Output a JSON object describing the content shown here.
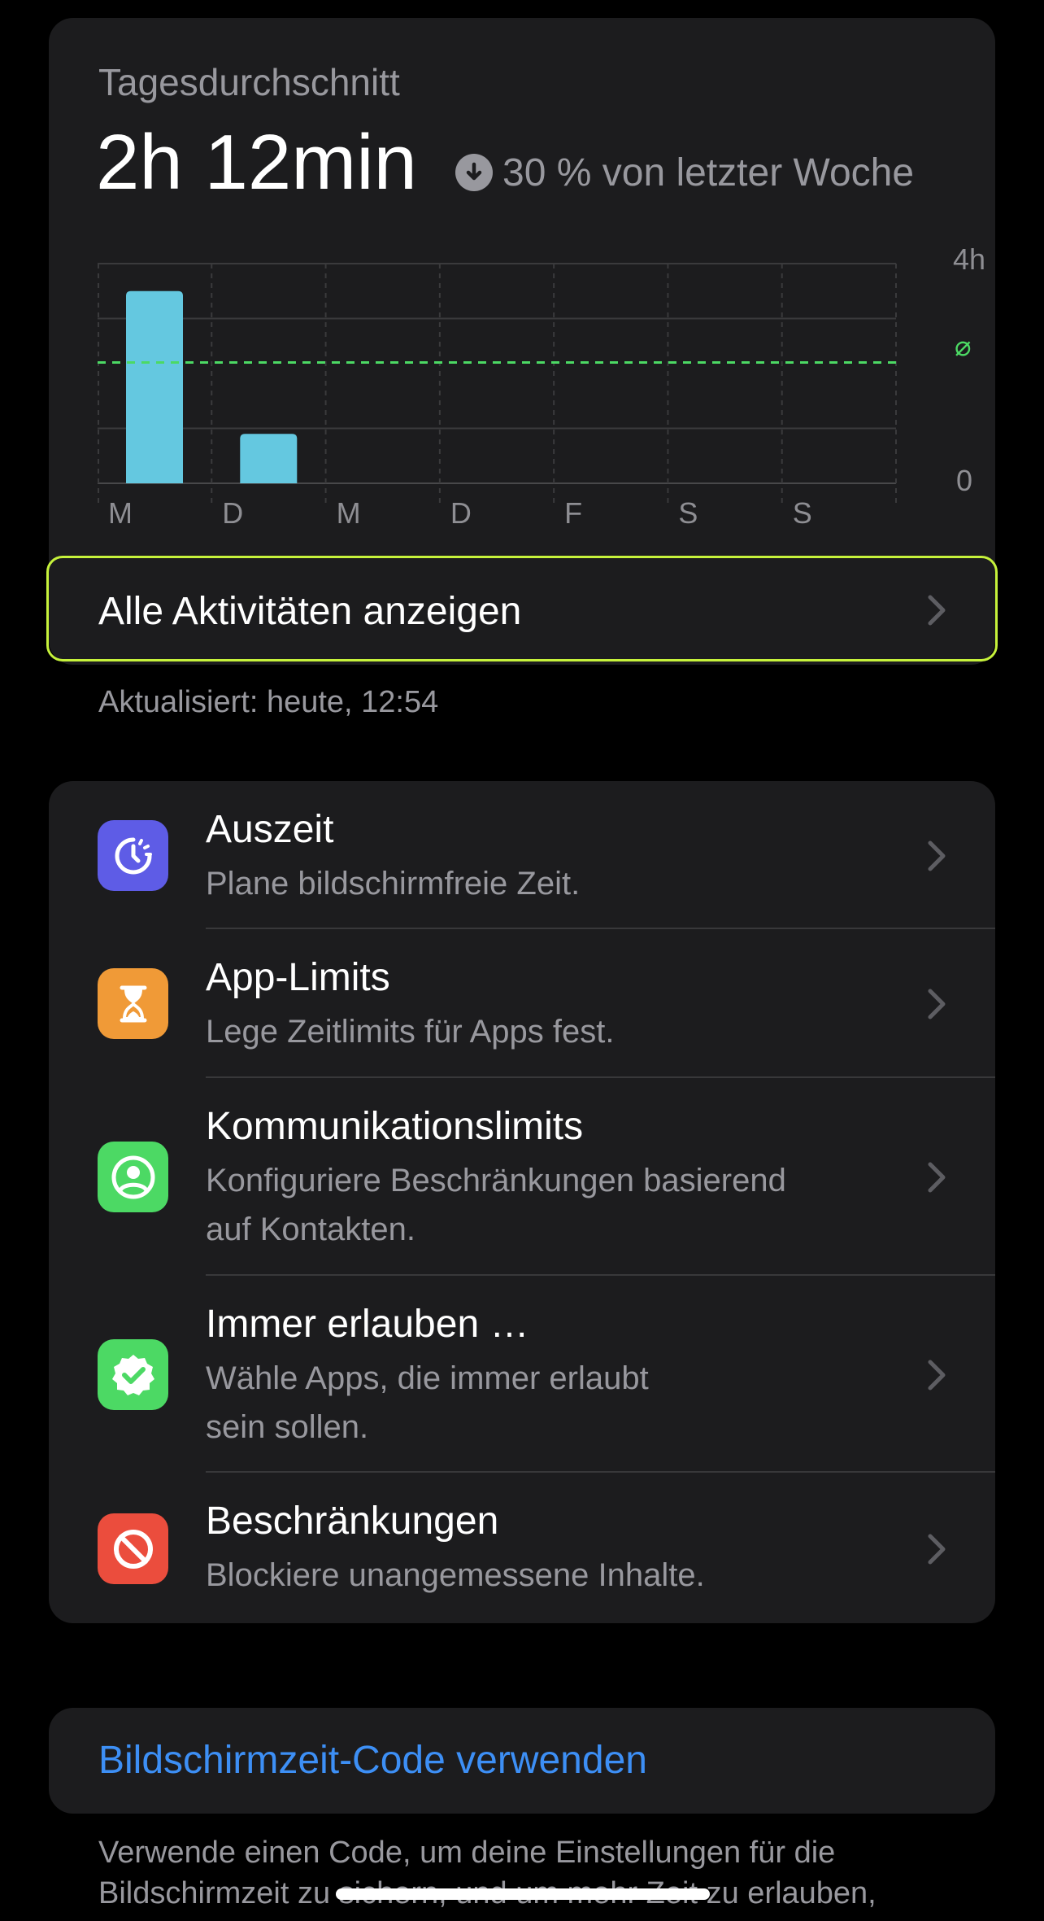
{
  "summary": {
    "label": "Tagesdurchschnitt",
    "value": "2h 12min",
    "trend_text": "30 % von letzter Woche",
    "trend_icon": "arrow-down-circle-icon"
  },
  "chart_data": {
    "type": "bar",
    "categories": [
      "M",
      "D",
      "M",
      "D",
      "F",
      "S",
      "S"
    ],
    "values": [
      3.5,
      0.9,
      0,
      0,
      0,
      0,
      0
    ],
    "ylim": [
      0,
      4
    ],
    "ytick_labels": [
      "4h",
      "0"
    ],
    "average": 2.2,
    "average_label": "⌀",
    "bar_color": "#64c8e0",
    "average_color": "#4cd964",
    "grid": true
  },
  "all_activities": {
    "label": "Alle Aktivitäten anzeigen",
    "highlight_color": "#c6f23b"
  },
  "updated": "Aktualisiert: heute, 12:54",
  "features": [
    {
      "title": "Auszeit",
      "subtitle": "Plane bildschirmfreie Zeit.",
      "icon": "downtime-icon",
      "color": "#5e5ce6"
    },
    {
      "title": "App-Limits",
      "subtitle": "Lege Zeitlimits für Apps fest.",
      "icon": "hourglass-icon",
      "color": "#f09a37"
    },
    {
      "title": "Kommunikationslimits",
      "subtitle": "Konfiguriere Beschränkungen basierend\nauf Kontakten.",
      "icon": "person-circle-icon",
      "color": "#4cd964"
    },
    {
      "title": "Immer erlauben …",
      "subtitle": "Wähle Apps, die immer erlaubt\nsein sollen.",
      "icon": "checkmark-seal-icon",
      "color": "#4cd964"
    },
    {
      "title": "Beschränkungen",
      "subtitle": "Blockiere unangemessene Inhalte.",
      "icon": "no-entry-icon",
      "color": "#eb4d3d"
    }
  ],
  "code": {
    "label": "Bildschirmzeit-Code verwenden",
    "color": "#3d8ff5"
  },
  "footer": "Verwende einen Code, um deine Einstellungen für die Bildschirmzeit zu sichern, und um mehr Zeit zu erlauben,"
}
